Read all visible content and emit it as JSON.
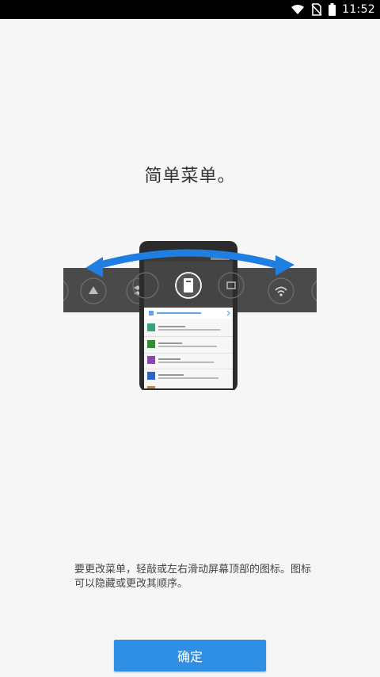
{
  "status_bar": {
    "time": "11:52",
    "icons": [
      "wifi-icon",
      "no-sim-icon",
      "battery-icon"
    ]
  },
  "screen": {
    "title": "简单菜单。",
    "description": "要更改菜单，轻敲或左右滑动屏幕顶部的图标。图标可以隐藏或更改其顺序。",
    "confirm_button": "确定"
  },
  "colors": {
    "accent": "#2f8fe5",
    "arrow": "#1e7fe0",
    "strip": "#4a4a4a"
  }
}
